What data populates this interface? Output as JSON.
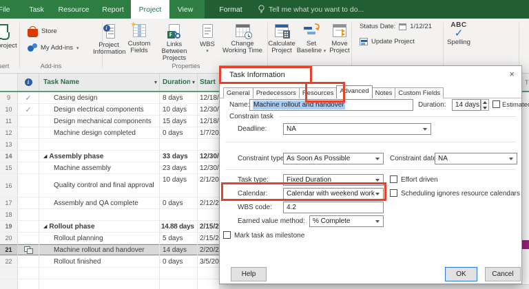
{
  "colors": {
    "ribbon_green": "#2e7d43",
    "contextual_green": "#215f33",
    "accent_green": "#217346",
    "annotation_red": "#e8402a",
    "selection_blue": "#abcdf3",
    "gantt_bar_magenta": "#a0207c"
  },
  "icons": {
    "check": "✓",
    "collapse_marker": "◢",
    "close": "×",
    "caret": "▾",
    "filter": "▾",
    "star": "★",
    "info_letter": "i",
    "p_letter": "P",
    "spell_check": "✓"
  },
  "tabbar": {
    "file": "File",
    "task": "Task",
    "resource": "Resource",
    "report": "Report",
    "project": "Project",
    "view": "View",
    "format": "Format",
    "tellme": "Tell me what you want to do..."
  },
  "ribbon": {
    "groups": {
      "insert": "Insert",
      "addins": "Add-ins",
      "properties": "Properties"
    },
    "buttons": {
      "subproject": "Subproject",
      "store": "Store",
      "my_addins": "My Add-ins",
      "project_information": [
        "Project",
        "Information"
      ],
      "custom_fields": [
        "Custom",
        "Fields"
      ],
      "links_between": [
        "Links Between",
        "Projects"
      ],
      "wbs": "WBS",
      "change_working_time": [
        "Change",
        "Working Time"
      ],
      "calculate_project": [
        "Calculate",
        "Project"
      ],
      "set_baseline": [
        "Set",
        "Baseline"
      ],
      "move_project": [
        "Move",
        "Project"
      ],
      "status_date_label": "Status Date:",
      "status_date_value": "1/12/21",
      "update_project": "Update Project",
      "spelling_abc": "ABC",
      "spelling": "Spelling"
    }
  },
  "table": {
    "header": {
      "task_name": "Task Name",
      "duration": "Duration",
      "start": "Start"
    },
    "rows": [
      {
        "id": "9",
        "indicator": "check",
        "name": "Casing design",
        "duration": "8 days",
        "start": "12/18/"
      },
      {
        "id": "10",
        "indicator": "check",
        "name": "Design electrical components",
        "duration": "10 days",
        "start": "12/30/"
      },
      {
        "id": "11",
        "indicator": "",
        "name": "Design mechanical components",
        "duration": "15 days",
        "start": "12/18/"
      },
      {
        "id": "12",
        "indicator": "",
        "name": "Machine design completed",
        "duration": "0 days",
        "start": "1/7/20"
      },
      {
        "id": "13",
        "indicator": "",
        "name": "",
        "duration": "",
        "start": ""
      },
      {
        "id": "14",
        "indicator": "",
        "name": "Assembly phase",
        "duration": "33 days",
        "start": "12/30/",
        "type": "summary"
      },
      {
        "id": "15",
        "indicator": "",
        "name": "Machine assembly",
        "duration": "23 days",
        "start": "12/30/"
      },
      {
        "id": "16",
        "indicator": "",
        "name": "Quality control and final approval",
        "duration": "10 days",
        "start": "2/1/20",
        "tall": true
      },
      {
        "id": "17",
        "indicator": "",
        "name": "Assembly and QA complete",
        "duration": "0 days",
        "start": "2/12/2"
      },
      {
        "id": "18",
        "indicator": "",
        "name": "",
        "duration": "",
        "start": ""
      },
      {
        "id": "19",
        "indicator": "",
        "name": "Rollout phase",
        "duration": "14.88 days",
        "start": "2/15/2",
        "type": "summary"
      },
      {
        "id": "20",
        "indicator": "",
        "name": "Rollout planning",
        "duration": "5 days",
        "start": "2/15/2"
      },
      {
        "id": "21",
        "indicator": "calendar",
        "name": "Machine rollout and handover",
        "duration": "14 days",
        "start": "2/20/2",
        "selected": true
      },
      {
        "id": "22",
        "indicator": "",
        "name": "Rollout finished",
        "duration": "0 days",
        "start": "3/5/20"
      }
    ]
  },
  "gantt": {
    "timescale_label": "T"
  },
  "dialog": {
    "title": "Task Information",
    "tabs": [
      "General",
      "Predecessors",
      "Resources",
      "Advanced",
      "Notes",
      "Custom Fields"
    ],
    "active_tab": "Advanced",
    "name_label": "Name:",
    "name_value": "Machine rollout and handover",
    "duration_label": "Duration:",
    "duration_value": "14 days",
    "estimated_label": "Estimated",
    "estimated_checked": false,
    "constrain_group_label": "Constrain task",
    "deadline_label": "Deadline:",
    "deadline_value": "NA",
    "constraint_type_label": "Constraint type:",
    "constraint_type_value": "As Soon As Possible",
    "constraint_date_label": "Constraint date:",
    "constraint_date_value": "NA",
    "task_type_label": "Task type:",
    "task_type_value": "Fixed Duration",
    "effort_driven_label": "Effort driven",
    "effort_driven_checked": false,
    "calendar_label": "Calendar:",
    "calendar_value": "Calendar with weekend work",
    "scheduling_label": "Scheduling ignores resource calendars",
    "scheduling_checked": false,
    "wbs_label": "WBS code:",
    "wbs_value": "4.2",
    "evm_label": "Earned value method:",
    "evm_value": "% Complete",
    "milestone_label": "Mark task as milestone",
    "milestone_checked": false,
    "help_button": "Help",
    "ok_button": "OK",
    "cancel_button": "Cancel"
  }
}
